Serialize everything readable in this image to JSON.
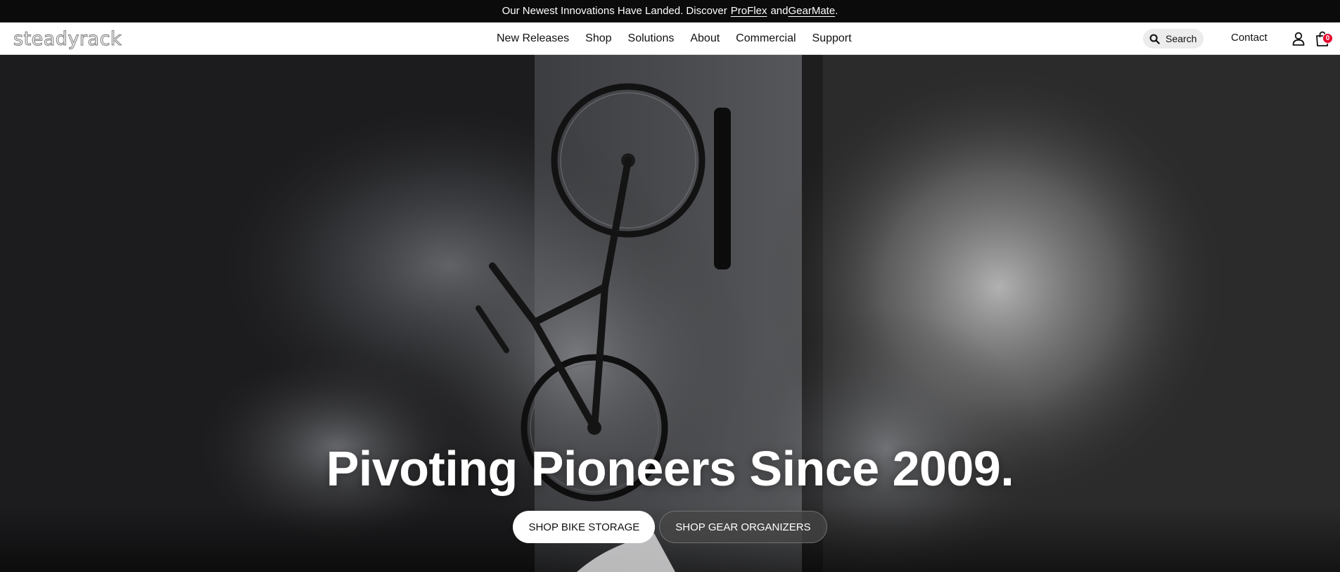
{
  "announcement": {
    "prefix": "Our Newest Innovations Have Landed. Discover",
    "link1": "ProFlex",
    "joiner": "and",
    "link2": "GearMate",
    "suffix": "."
  },
  "header": {
    "logo_text": "steadyrack",
    "nav": [
      "New Releases",
      "Shop",
      "Solutions",
      "About",
      "Commercial",
      "Support"
    ],
    "search_label": "Search",
    "contact_label": "Contact",
    "cart_count": "0",
    "badge_color": "#e4002b"
  },
  "hero": {
    "title": "Pivoting Pioneers Since 2009.",
    "primary_button": "SHOP BIKE STORAGE",
    "secondary_button": "SHOP GEAR ORGANIZERS"
  }
}
